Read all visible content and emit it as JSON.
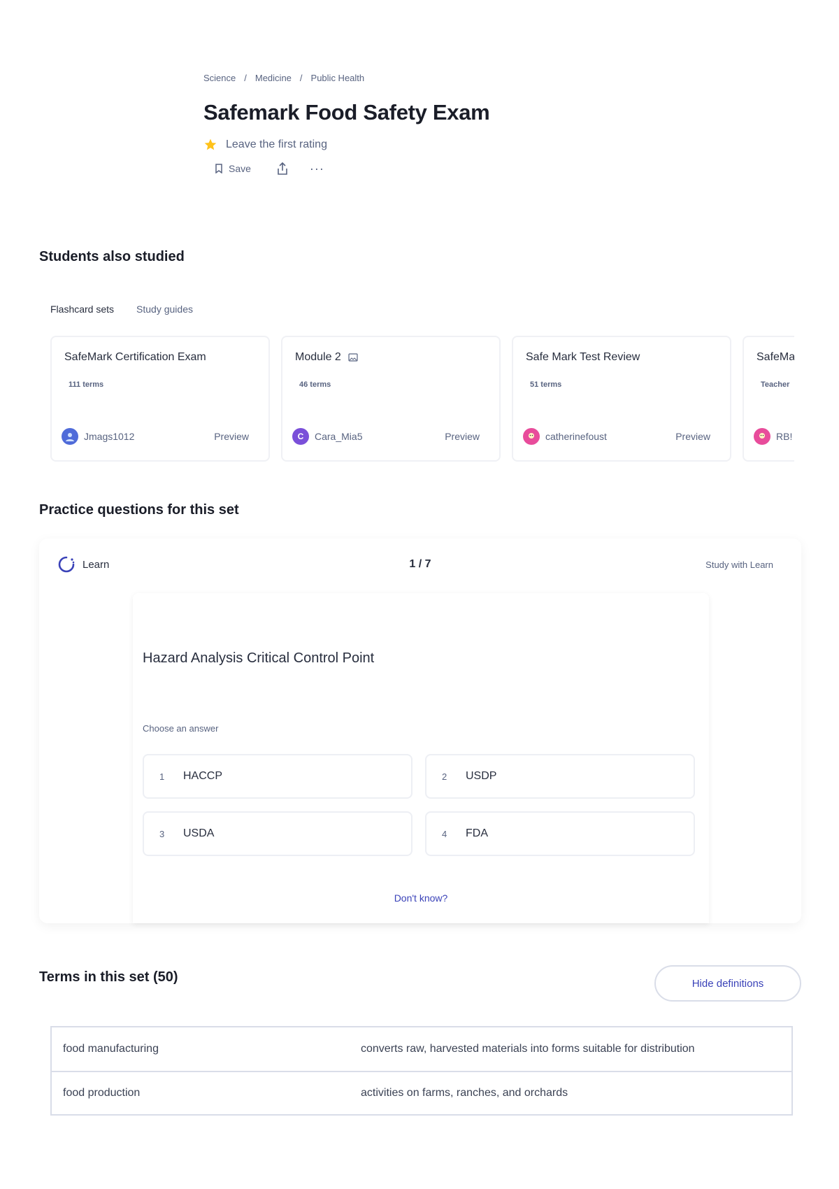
{
  "breadcrumb": [
    "Science",
    "Medicine",
    "Public Health"
  ],
  "title": "Safemark Food Safety Exam",
  "rating_text": "Leave the first rating",
  "actions": {
    "save_label": "Save"
  },
  "students_section": {
    "heading": "Students also studied",
    "tabs": [
      "Flashcard sets",
      "Study guides"
    ],
    "cards": [
      {
        "title": "SafeMark Certification Exam",
        "terms": "111 terms",
        "author": "Jmags1012",
        "preview": "Preview",
        "avatar_color": "#4f6bd9",
        "avatar_letter": "",
        "has_image_icon": false
      },
      {
        "title": "Module 2",
        "terms": "46 terms",
        "author": "Cara_Mia5",
        "preview": "Preview",
        "avatar_color": "#7a4fd9",
        "avatar_letter": "C",
        "has_image_icon": true
      },
      {
        "title": "Safe Mark Test Review",
        "terms": "51 terms",
        "author": "catherinefoust",
        "preview": "Preview",
        "avatar_color": "#e84c9b",
        "avatar_letter": "",
        "has_image_icon": false
      },
      {
        "title": "SafeMa",
        "terms": "Teacher",
        "author": "RB!",
        "preview": "",
        "avatar_color": "#e84c9b",
        "avatar_letter": "",
        "has_image_icon": false
      }
    ]
  },
  "practice_section": {
    "heading": "Practice questions for this set",
    "learn_label": "Learn",
    "counter": "1 / 7",
    "study_link": "Study with Learn",
    "question": "Hazard Analysis Critical Control Point",
    "choose_label": "Choose an answer",
    "answers": [
      {
        "num": "1",
        "label": "HACCP"
      },
      {
        "num": "2",
        "label": "USDP"
      },
      {
        "num": "3",
        "label": "USDA"
      },
      {
        "num": "4",
        "label": "FDA"
      }
    ],
    "dont_know": "Don't know?"
  },
  "terms_section": {
    "heading": "Terms in this set (50)",
    "hide_button": "Hide definitions",
    "rows": [
      {
        "term": "food manufacturing",
        "definition": "converts raw, harvested materials into forms suitable for distribution"
      },
      {
        "term": "food production",
        "definition": "activities on farms, ranches, and orchards"
      }
    ]
  },
  "colors": {
    "accent": "#3a42b8",
    "star": "#ffc21a",
    "text": "#282e3e",
    "muted": "#586380"
  }
}
